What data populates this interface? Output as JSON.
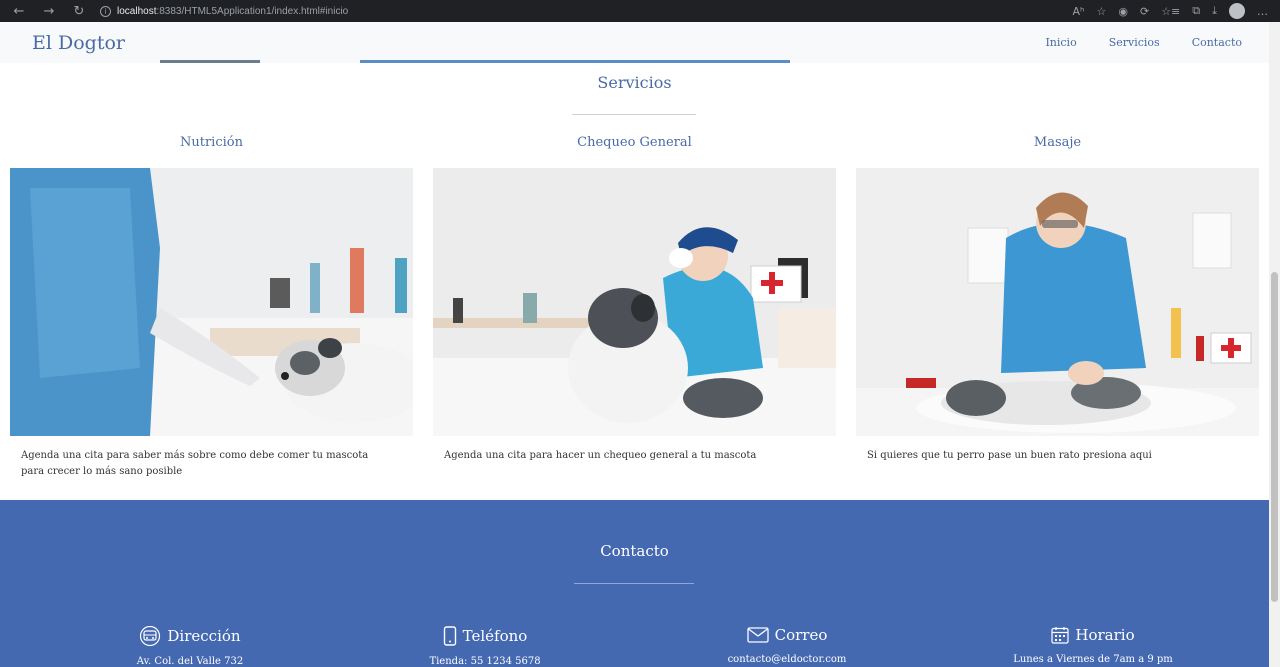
{
  "browser": {
    "url_host": "localhost",
    "url_rest": ":8383/HTML5Application1/index.html#inicio",
    "back_icon": "←",
    "forward_icon": "→",
    "reload_icon": "↻",
    "info_icon": "i",
    "right_icons": [
      "Aʰ",
      "☆",
      "◉",
      "⟳",
      "☆≡",
      "⧉",
      "⤓",
      "…"
    ]
  },
  "nav": {
    "brand": "El Dogtor",
    "links": [
      "Inicio",
      "Servicios",
      "Contacto"
    ]
  },
  "services": {
    "title": "Servicios",
    "cards": [
      {
        "title": "Nutrición",
        "text": "Agenda una cita para saber más sobre como debe comer tu mascota para crecer lo más sano posible"
      },
      {
        "title": "Chequeo General",
        "text": "Agenda una cita para hacer un chequeo general a tu mascota"
      },
      {
        "title": "Masaje",
        "text": "Si quieres que tu perro pase un buen rato presiona aqui"
      }
    ]
  },
  "contact": {
    "title": "Contacto",
    "items": [
      {
        "label": "Dirección",
        "value": "Av. Col. del Valle 732",
        "icon": "bus-icon"
      },
      {
        "label": "Teléfono",
        "value": "Tienda: 55 1234 5678",
        "icon": "phone-icon"
      },
      {
        "label": "Correo",
        "value": "contacto@eldoctor.com",
        "icon": "envelope-icon"
      },
      {
        "label": "Horario",
        "value": "Lunes a Viernes de 7am a 9 pm",
        "icon": "calendar-icon"
      }
    ]
  },
  "colors": {
    "accent": "#4a6aa5",
    "contact_bg": "#4469b0"
  }
}
